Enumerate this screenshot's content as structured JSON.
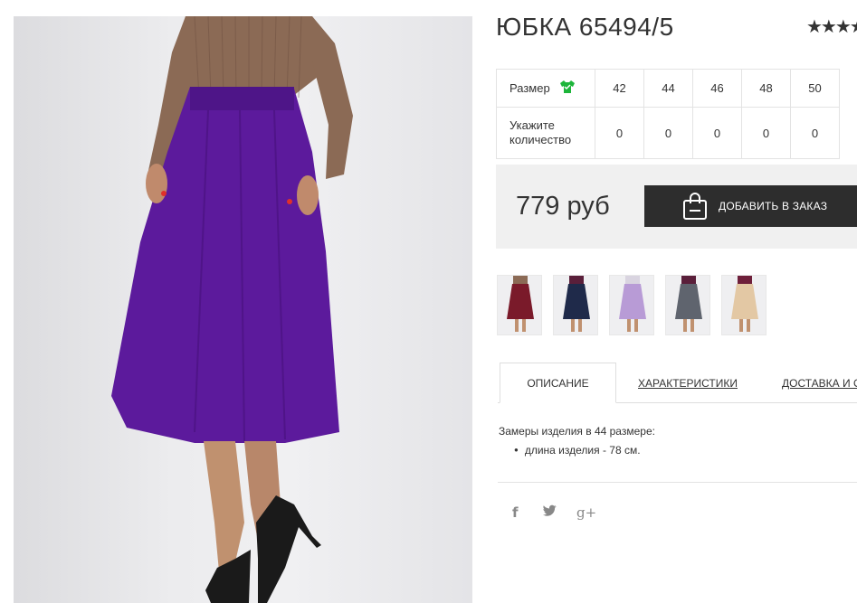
{
  "product": {
    "title": "ЮБКА 65494/5",
    "rating_stars": "★★★★",
    "price": "779 руб",
    "add_to_order_label": "ДОБАВИТЬ В ЗАКАЗ",
    "skirt_color": "#5c1a9c"
  },
  "size_table": {
    "size_label": "Размер",
    "size_icon": "green-shirt-icon",
    "size_icon_color": "#1db53a",
    "sizes": [
      "42",
      "44",
      "46",
      "48",
      "50"
    ],
    "quantity_label_1": "Укажите",
    "quantity_label_2": "количество",
    "quantities": [
      "0",
      "0",
      "0",
      "0",
      "0"
    ]
  },
  "thumbnails": [
    {
      "color_name": "burgundy",
      "skirt_color": "#7a1a2a"
    },
    {
      "color_name": "navy",
      "skirt_color": "#1f2a4a"
    },
    {
      "color_name": "lilac",
      "skirt_color": "#b89bd6"
    },
    {
      "color_name": "grey",
      "skirt_color": "#5f646e"
    },
    {
      "color_name": "beige",
      "skirt_color": "#e3c8a4"
    }
  ],
  "tabs": [
    {
      "label": "ОПИСАНИЕ",
      "active": true
    },
    {
      "label": "ХАРАКТЕРИСТИКИ",
      "active": false
    },
    {
      "label": "ДОСТАВКА И О",
      "active": false
    }
  ],
  "description": {
    "intro": "Замеры изделия в 44 размере:",
    "items": [
      "длина изделия - 78 см."
    ]
  },
  "social": {
    "facebook": "f",
    "twitter_icon": "twitter-icon",
    "googleplus": "g+"
  }
}
